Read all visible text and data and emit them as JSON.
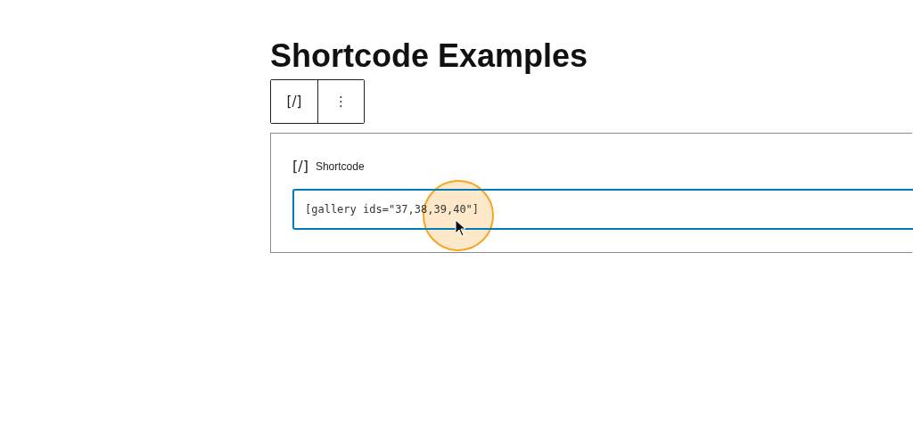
{
  "title": "Shortcode Examples",
  "toolbar": {
    "buttons": [
      "[/]",
      "⋮"
    ]
  },
  "block": {
    "icon": "[/]",
    "label": "Shortcode",
    "value": "[gallery ids=\"37,38,39,40\"]",
    "focused": true
  }
}
